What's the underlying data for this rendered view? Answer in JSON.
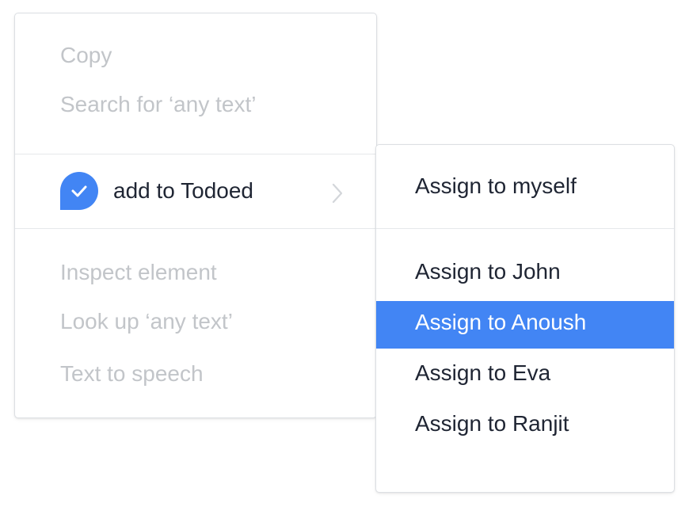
{
  "context_menu": {
    "copy_label": "Copy",
    "search_label": "Search for ‘any text’",
    "todoed": {
      "label": "add to Todoed",
      "icon": "check-bubble-icon",
      "chevron": "chevron-right-icon"
    },
    "inspect_label": "Inspect element",
    "lookup_label": "Look up ‘any text’",
    "speech_label": "Text to speech"
  },
  "submenu": {
    "items": [
      {
        "label": "Assign to myself"
      },
      {
        "label": "Assign to John"
      },
      {
        "label": "Assign to Anoush",
        "selected": true
      },
      {
        "label": "Assign to Eva"
      },
      {
        "label": "Assign to Ranjit"
      }
    ]
  },
  "colors": {
    "accent": "#4285f4",
    "text_primary": "#1f2533",
    "text_disabled": "#c2c5c9",
    "divider": "#e6e8eb",
    "border": "#dcdfe3"
  }
}
